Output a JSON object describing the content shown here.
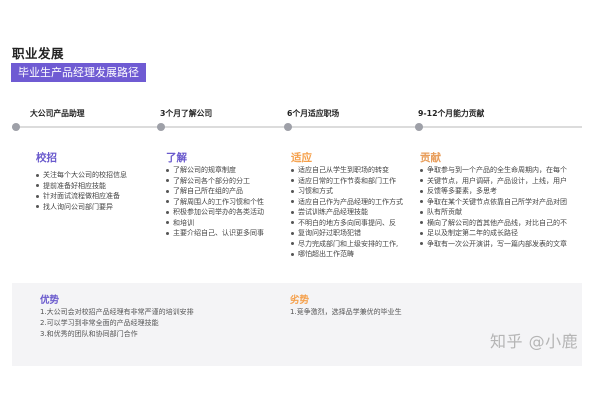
{
  "title": "职业发展",
  "subtitle": "毕业生产品经理发展路径",
  "stages": [
    {
      "heading": "大公司产品助理",
      "column_title": "校招",
      "items": [
        "关注每个大公司的校招信息",
        "提前准备好相应技能",
        "针对面试流程做相应准备",
        "找人询问公司部门要异"
      ]
    },
    {
      "heading": "3个月了解公司",
      "column_title": "了解",
      "items": [
        "了解公司的规章制度",
        "了解公司各个部分的分工",
        "了解自己所在组的产品",
        "了解周围人的工作习惯和个性",
        "积极参加公司举办的各类活动",
        "和培训",
        "主要介绍自己、认识更多同事"
      ]
    },
    {
      "heading": "6个月适应职场",
      "column_title": "适应",
      "items": [
        "适应自己从学生到职场的转变",
        "适应日常的工作节奏和部门工作",
        "习惯和方式",
        "适应自己作为产品经理的工作方式",
        "尝试训练产品经理技能",
        "不明白的地方多向同事提问、反",
        "复询问好过职场犯错",
        "尽力完成部门和上级安排的工作,",
        "哪怕超出工作范畴"
      ]
    },
    {
      "heading": "9-12个月能力贡献",
      "column_title": "贡献",
      "items": [
        "争取参与到一个产品的全生命周期内，在每个",
        "关键节点，用户调研，产品设计，上线，用户",
        "反馈等多要素，多思考",
        "争取在某个关键节点依靠自己所学对产品对团",
        "队有所贡献",
        "横向了解公司的首其他产品线，对比自己的不",
        "足以及制定第二年的成长路径",
        "争取有一次公开演讲，写一篇内部发表的文章"
      ]
    }
  ],
  "advantages": {
    "title": "优势",
    "items": [
      "1.大公司会对校招产品经理有非常严谨的培训安排",
      "2.可以学习到非常全面的产品经理技能",
      "3.和优秀的团队和协同部门合作"
    ]
  },
  "disadvantages": {
    "title": "劣势",
    "items": [
      "1.竞争激烈，选择品学兼优的毕业生"
    ]
  },
  "watermark": "知乎 @小鹿"
}
